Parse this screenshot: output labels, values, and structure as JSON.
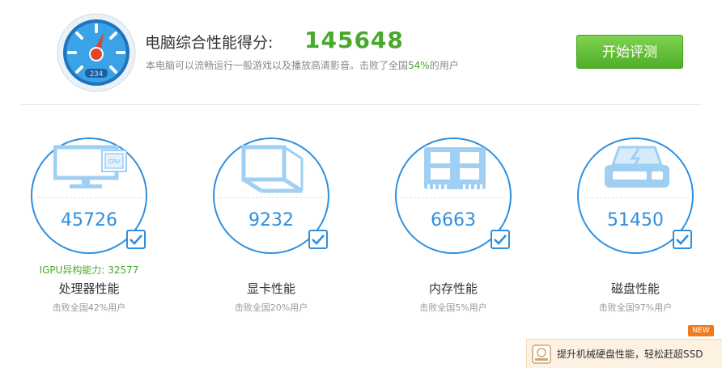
{
  "header": {
    "gauge_digits": "234",
    "score_title": "电脑综合性能得分:",
    "score_value": "145648",
    "desc_prefix": "本电脑可以流畅运行一般游戏以及播放高清影音。击败了全国",
    "desc_percent": "54%",
    "desc_suffix": "的用户",
    "start_button": "开始评测"
  },
  "cards": [
    {
      "score": "45726",
      "label": "处理器性能",
      "sub": "击败全国42%用户",
      "extra": "IGPU异构能力: 32577",
      "icon": "monitor-cpu-icon"
    },
    {
      "score": "9232",
      "label": "显卡性能",
      "sub": "击败全国20%用户",
      "icon": "cube-icon"
    },
    {
      "score": "6663",
      "label": "内存性能",
      "sub": "击败全国5%用户",
      "icon": "memory-chip-icon"
    },
    {
      "score": "51450",
      "label": "磁盘性能",
      "sub": "击败全国97%用户",
      "icon": "hard-disk-icon"
    }
  ],
  "promo": {
    "text": "提升机械硬盘性能，轻松赶超SSD",
    "badge": "NEW"
  },
  "colors": {
    "accent_blue": "#2f8fde",
    "accent_green": "#4aa82a",
    "promo_bg": "#fdf2e1",
    "badge_orange": "#f27a1e"
  }
}
